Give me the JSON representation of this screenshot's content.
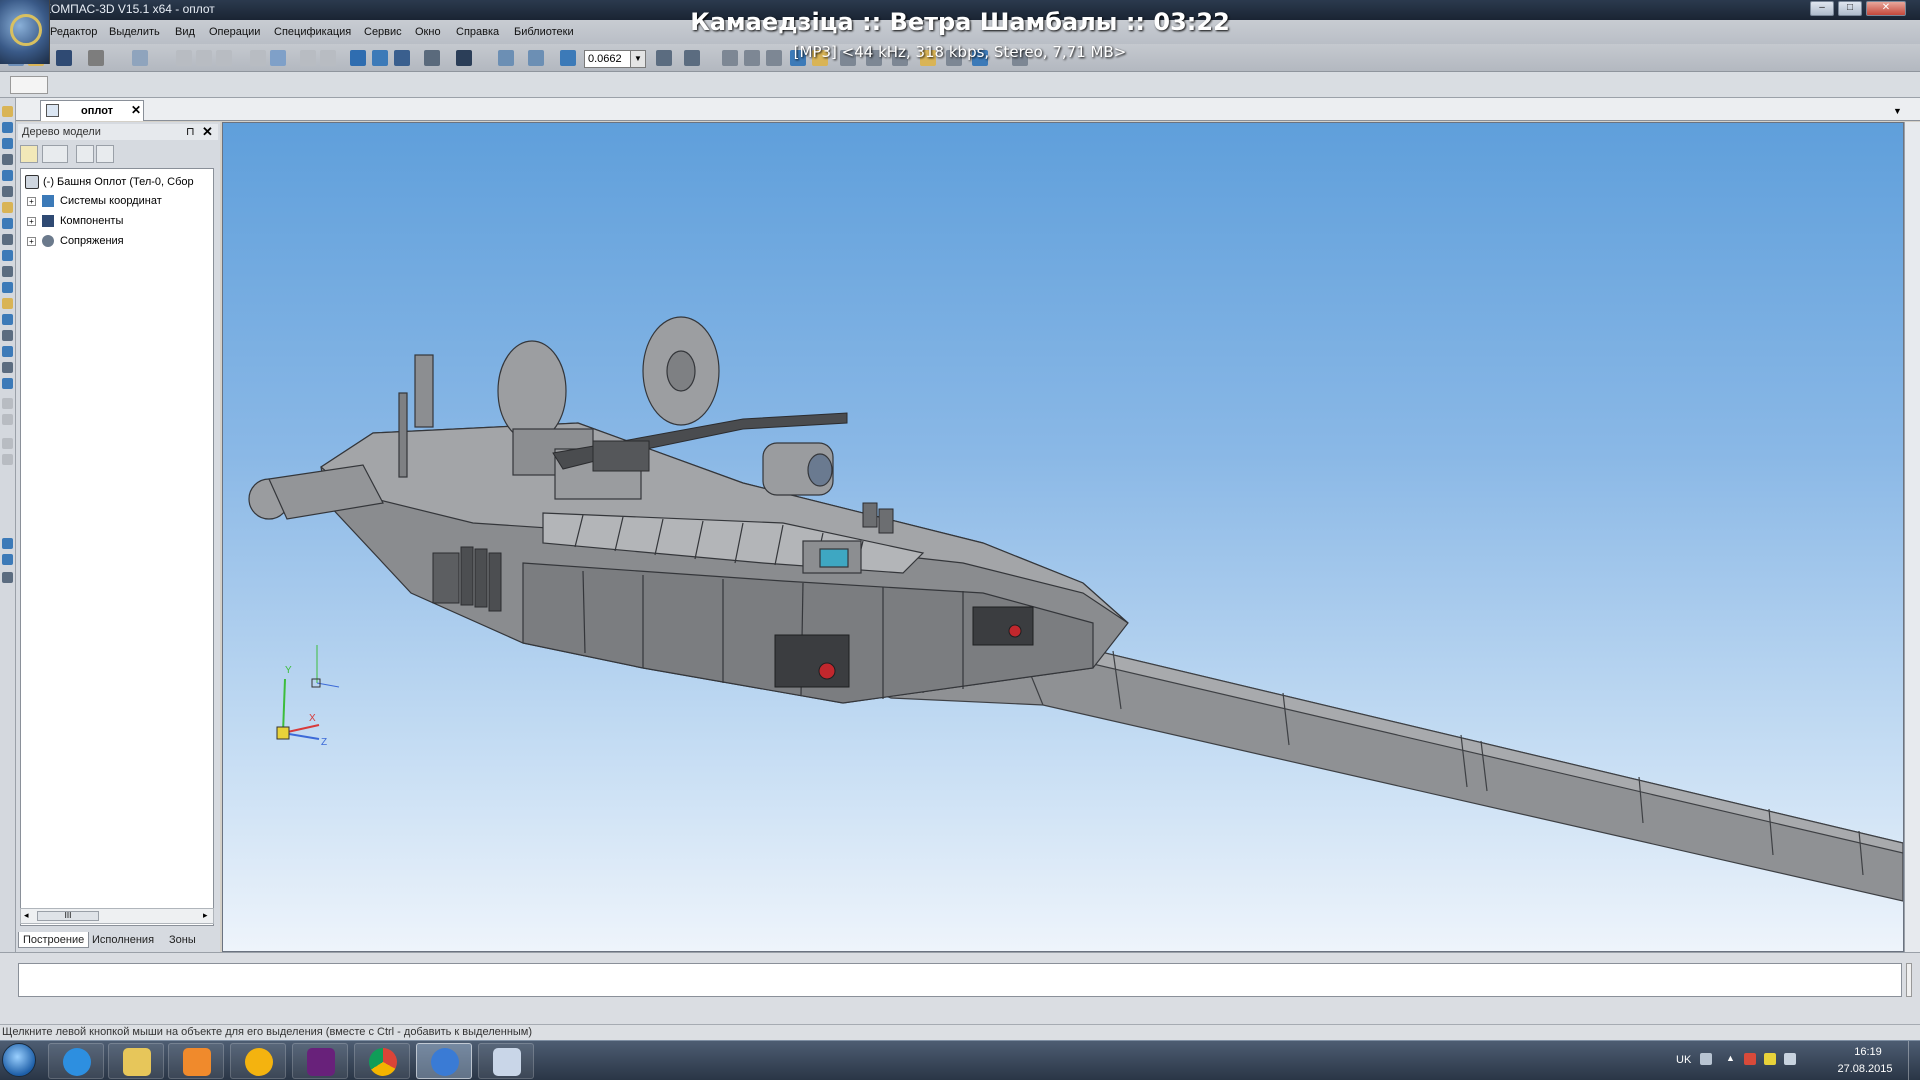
{
  "window": {
    "title": "КОМПАС-3D V15.1 x64 - оплот",
    "minimize": "–",
    "maximize": "□",
    "close": "✕"
  },
  "menu": [
    "Редактор",
    "Выделить",
    "Вид",
    "Операции",
    "Спецификация",
    "Сервис",
    "Окно",
    "Справка",
    "Библиотеки"
  ],
  "media_overlay": {
    "track": "Камаедзіца :: Ветра Шамбалы :: 03:22",
    "info": "[MP3] <44 kHz, 318 kbps, Stereo, 7,71 MB>"
  },
  "toolbar": {
    "zoom_value": "0.0662"
  },
  "document_tab": {
    "label": "оплот",
    "close": "✕"
  },
  "tree_panel": {
    "title": "Дерево модели",
    "pin": "⊓",
    "close": "✕",
    "root_label": "(-) Башня Оплот (Тел-0, Сбор",
    "nodes": [
      "Системы координат",
      "Компоненты",
      "Сопряжения"
    ],
    "scroll_thumb": "III",
    "tabs": [
      "Построение",
      "Исполнения",
      "Зоны"
    ]
  },
  "axes_triad": {
    "labels": [
      "Y",
      "X",
      "Z"
    ]
  },
  "status": {
    "hint": "Щелкните левой кнопкой мыши на объекте для его выделения (вместе с Ctrl - добавить к выделенным)"
  },
  "taskbar": {
    "apps": [
      "internet-explorer",
      "file-explorer",
      "media-player",
      "aimp",
      "visual-studio",
      "chrome",
      "kompas",
      "paint"
    ],
    "language": "UK",
    "time": "16:19",
    "date": "27.08.2015"
  },
  "colors": {
    "viewport_top": "#5f9fdb",
    "viewport_bottom": "#eef4fb",
    "model_gray": "#8d8f92",
    "titlebar": "#1a2433",
    "taskbar": "#2a3646"
  }
}
